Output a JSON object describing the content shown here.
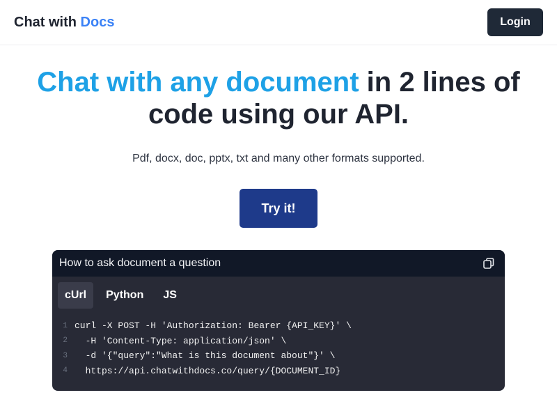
{
  "header": {
    "brand_main": "Chat with ",
    "brand_accent": "Docs",
    "login_label": "Login"
  },
  "hero": {
    "title_highlight": "Chat with any document",
    "title_rest": " in 2 lines of code using our API.",
    "subtitle": "Pdf, docx, doc, pptx, txt and many other formats supported.",
    "cta_label": "Try it!"
  },
  "code_card": {
    "title": "How to ask document a question",
    "tabs": [
      {
        "label": "cUrl",
        "active": true
      },
      {
        "label": "Python",
        "active": false
      },
      {
        "label": "JS",
        "active": false
      }
    ],
    "lines": [
      {
        "n": "1",
        "text": "curl -X POST -H 'Authorization: Bearer {API_KEY}' \\"
      },
      {
        "n": "2",
        "text": "  -H 'Content-Type: application/json' \\"
      },
      {
        "n": "3",
        "text": "  -d '{\"query\":\"What is this document about\"}' \\"
      },
      {
        "n": "4",
        "text": "  https://api.chatwithdocs.co/query/{DOCUMENT_ID}"
      }
    ]
  },
  "colors": {
    "brand_accent": "#3b82f6",
    "title_highlight": "#1ea1e6",
    "cta_bg": "#1e3a8a",
    "login_bg": "#1f2937",
    "code_bg": "#282a36"
  },
  "icons": {
    "copy": "copy-icon"
  }
}
